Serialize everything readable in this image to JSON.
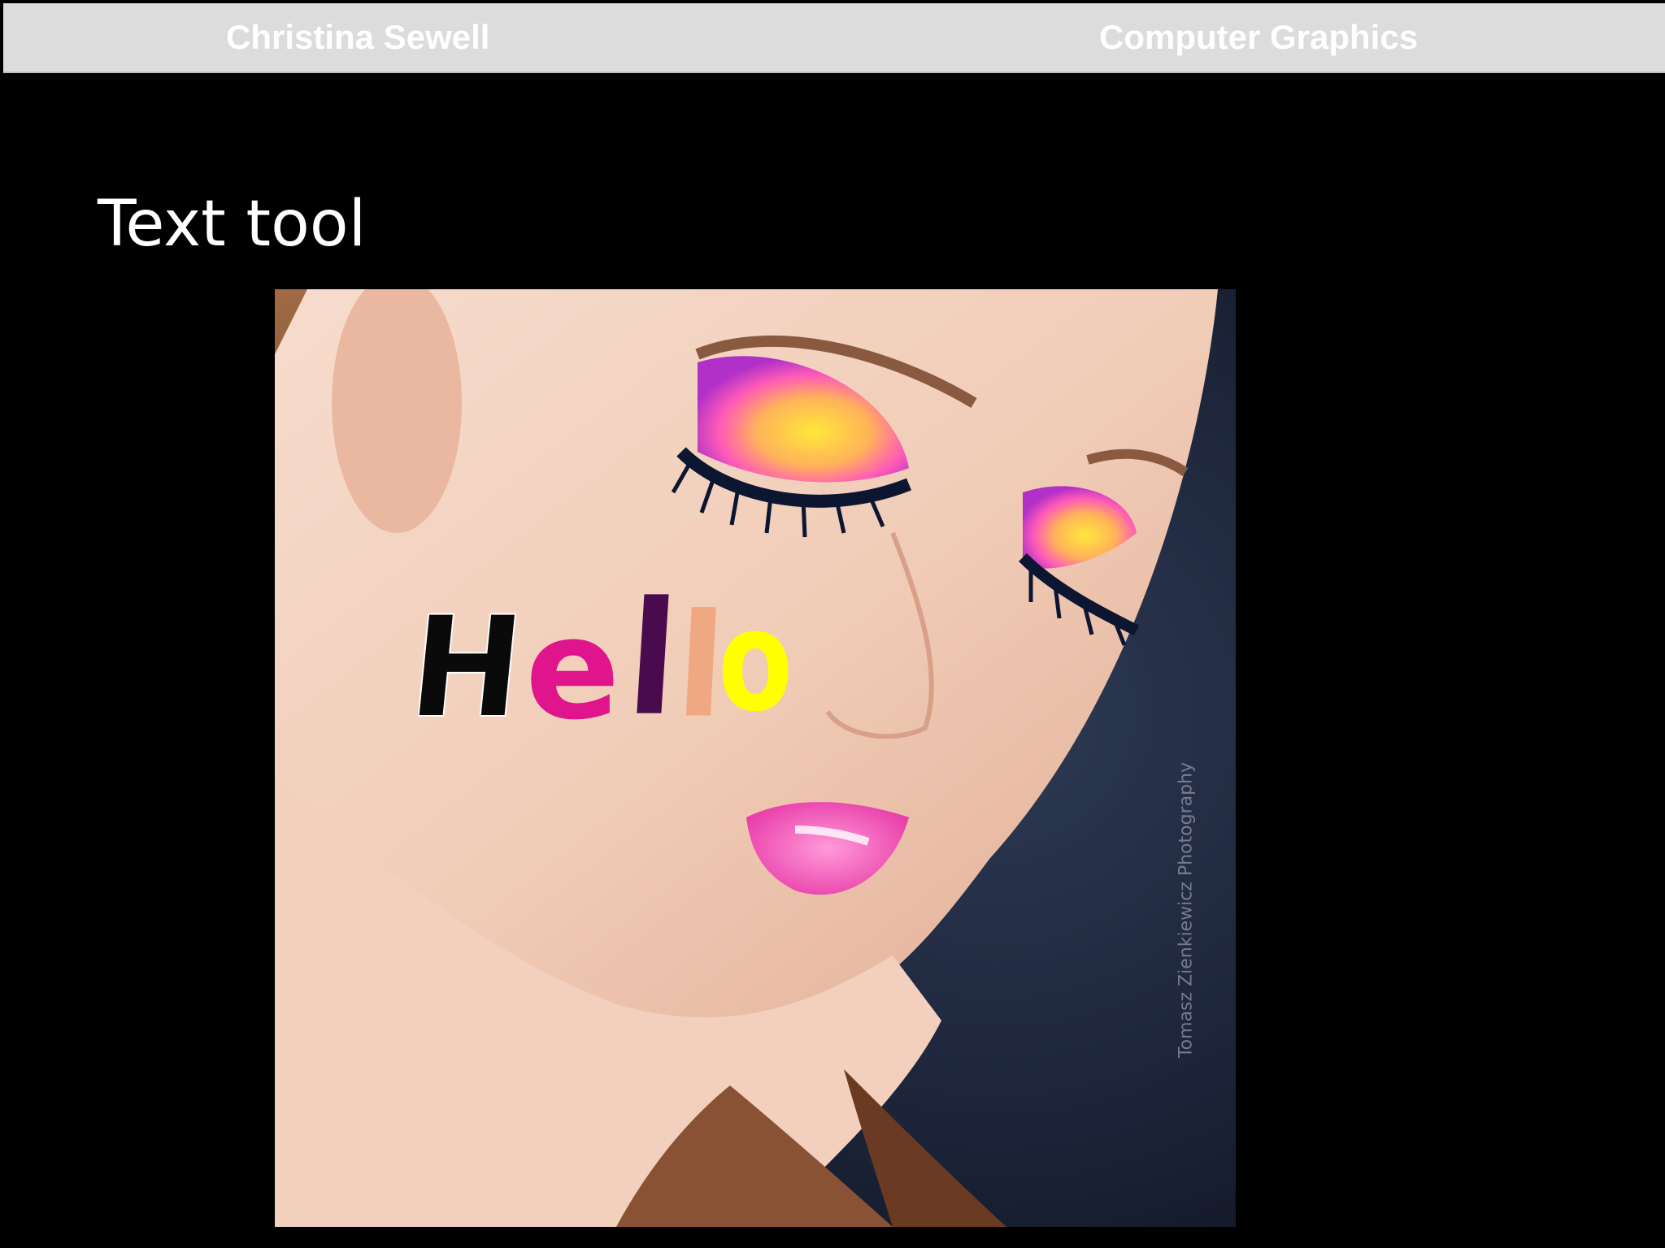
{
  "header": {
    "author": "Christina Sewell",
    "course": "Computer Graphics"
  },
  "slide": {
    "title": "Text tool"
  },
  "photo": {
    "description_icon": "portrait-photo",
    "watermark": "Tomasz Zienkiewicz Photography"
  },
  "hello_text": {
    "letters": [
      {
        "char": "H",
        "color": "#0a0a0a"
      },
      {
        "char": "e",
        "color": "#e0148c"
      },
      {
        "char": "l",
        "color": "#4a0a4e"
      },
      {
        "char": "l",
        "color": "#f0a882"
      },
      {
        "char": "o",
        "color": "#ffff00"
      }
    ]
  },
  "colors": {
    "header_bg": "#dcdcdc",
    "slide_bg": "#000000",
    "backdrop": "#1a2236"
  }
}
